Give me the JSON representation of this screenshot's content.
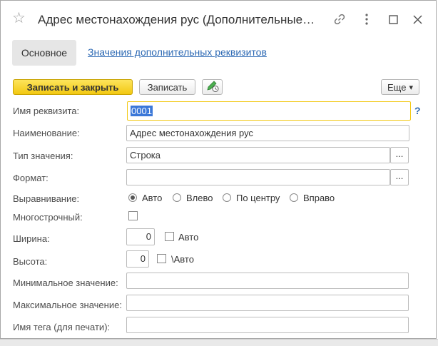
{
  "window": {
    "title": "Адрес местонахождения рус (Дополнительные р...",
    "star_icon": "star-icon",
    "link_icon": "link-icon",
    "menu_icon": "more-vertical-icon",
    "maximize_icon": "maximize-icon",
    "close_icon": "close-icon"
  },
  "tabs": {
    "main": "Основное",
    "values_link": "Значения дополнительных реквизитов"
  },
  "toolbar": {
    "save_close": "Записать и закрыть",
    "save": "Записать",
    "edit_icon": "pencil-clock-icon",
    "more": "Еще",
    "more_arrow": "▾"
  },
  "form": {
    "name_label": "Имя реквизита:",
    "name_value": "0001",
    "help": "?",
    "title_label": "Наименование:",
    "title_value": "Адрес местонахождения рус",
    "type_label": "Тип значения:",
    "type_value": "Строка",
    "type_btn": "...",
    "format_label": "Формат:",
    "format_value": "",
    "format_btn": "...",
    "align_label": "Выравнивание:",
    "align_options": [
      "Авто",
      "Влево",
      "По центру",
      "Вправо"
    ],
    "align_selected": "Авто",
    "multiline_label": "Многострочный:",
    "multiline_checked": false,
    "width_label": "Ширина:",
    "width_value": "0",
    "width_auto": "Авто",
    "height_label": "Высота:",
    "height_value": "0",
    "height_auto": "\\Авто",
    "min_label": "Минимальное значение:",
    "min_value": "",
    "max_label": "Максимальное значение:",
    "max_value": "",
    "tag_label": "Имя тега (для печати):",
    "tag_value": ""
  },
  "colors": {
    "primary_button": "#f2c811",
    "link": "#2e6ab4",
    "selection": "#3c78d8"
  }
}
